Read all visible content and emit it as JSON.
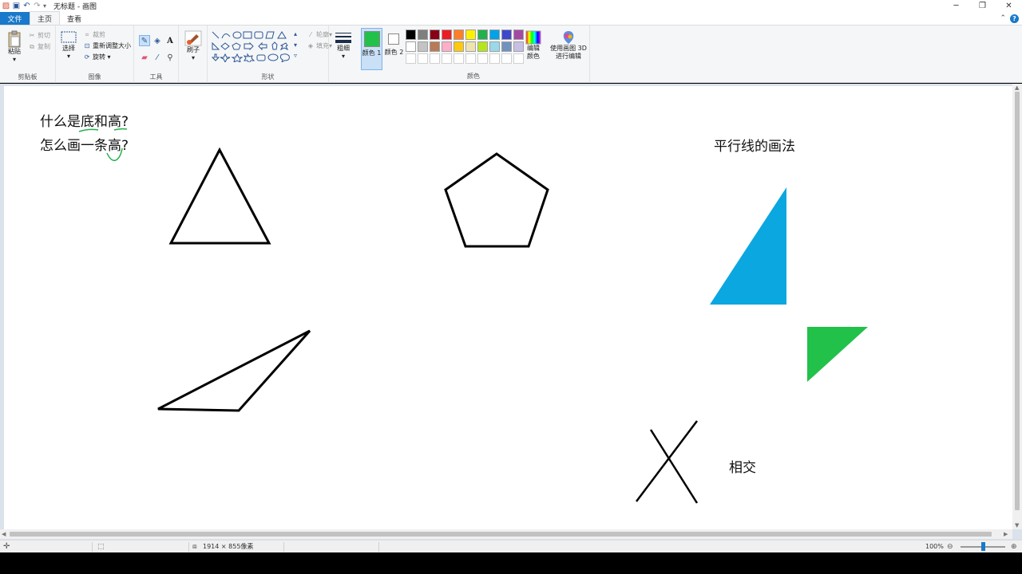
{
  "window": {
    "title": "无标题 - 画图",
    "minimize": "─",
    "restore": "❐",
    "close": "✕"
  },
  "tabs": {
    "file": "文件",
    "home": "主页",
    "view": "查看"
  },
  "ribbon": {
    "clipboard": {
      "label": "剪贴板",
      "paste": "粘贴",
      "cut": "剪切",
      "copy": "复制"
    },
    "image": {
      "label": "图像",
      "select": "选择",
      "crop": "裁剪",
      "resize": "重新调整大小",
      "rotate": "旋转"
    },
    "tools": {
      "label": "工具"
    },
    "brushes": {
      "label": "刷子"
    },
    "shapes": {
      "label": "形状",
      "outline": "轮廓",
      "fill": "填充"
    },
    "size": {
      "label": "粗细"
    },
    "color1": {
      "label": "颜色 1",
      "value": "#22c14a"
    },
    "color2": {
      "label": "颜色 2",
      "value": "#ffffff"
    },
    "colors": {
      "label": "颜色",
      "edit": "编辑颜色",
      "paint3d": "使用画图 3D 进行编辑",
      "palette": [
        "#000000",
        "#7f7f7f",
        "#880015",
        "#ed1c24",
        "#ff7f27",
        "#fff200",
        "#22b14c",
        "#00a2e8",
        "#3f48cc",
        "#a349a4",
        "#ffffff",
        "#c3c3c3",
        "#b97a57",
        "#ffaec9",
        "#ffc90e",
        "#efe4b0",
        "#b5e61d",
        "#99d9ea",
        "#7092be",
        "#c8bfe7",
        "#ffffff",
        "#ffffff",
        "#ffffff",
        "#ffffff",
        "#ffffff",
        "#ffffff",
        "#ffffff",
        "#ffffff",
        "#ffffff",
        "#ffffff"
      ]
    }
  },
  "canvas": {
    "line1": "什么是底和高?",
    "line2": "怎么画一条高?",
    "parallel_title": "平行线的画法",
    "intersect_label": "相交"
  },
  "status": {
    "dimensions": "1914 × 855像素",
    "zoom": "100%"
  }
}
